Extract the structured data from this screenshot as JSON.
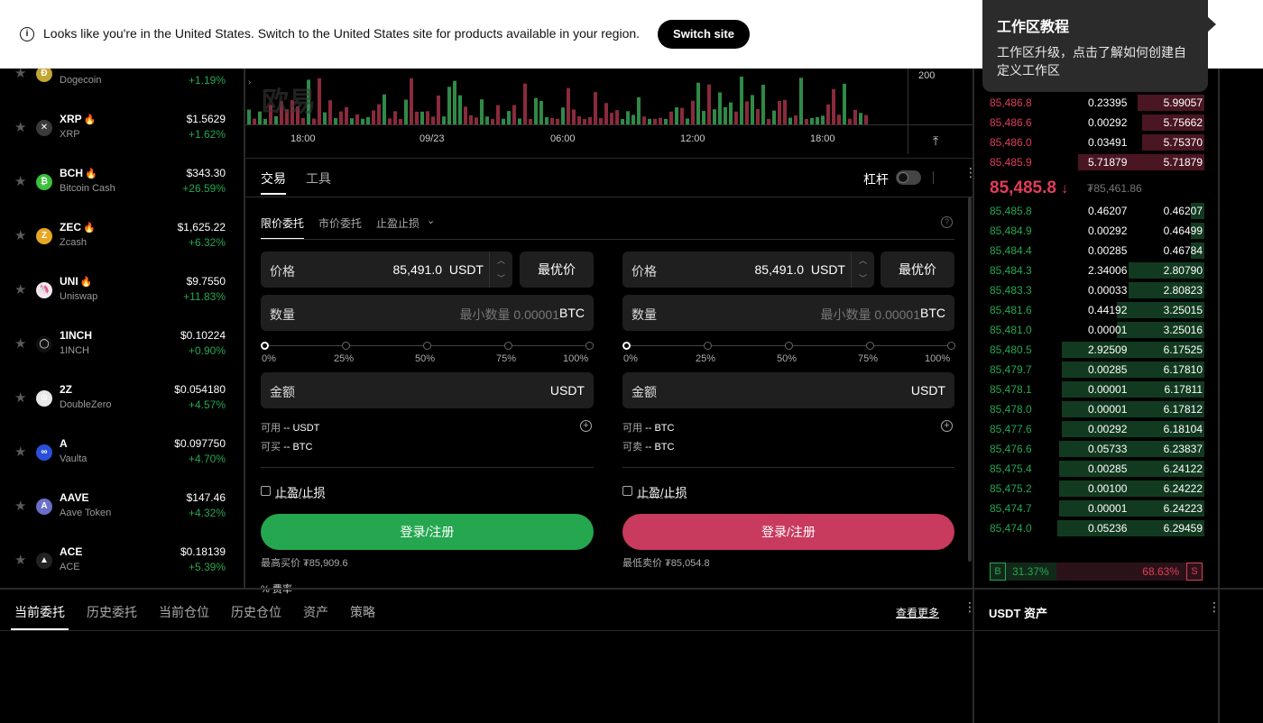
{
  "banner": {
    "message": "Looks like you're in the United States. Switch to the United States site for products available in your region.",
    "switch_label": "Switch site"
  },
  "tooltip": {
    "title": "工作区教程",
    "body": "工作区升级，点击了解如何创建自定义工作区"
  },
  "coins": [
    {
      "sym": "",
      "name": "Dogecoin",
      "price": "",
      "change": "+1.19%",
      "logo_color": "#c2a633",
      "logo_char": "Ð",
      "hot": false
    },
    {
      "sym": "XRP",
      "name": "XRP",
      "price": "$1.5629",
      "change": "+1.62%",
      "logo_color": "#3a3a3a",
      "logo_char": "✕",
      "hot": true
    },
    {
      "sym": "BCH",
      "name": "Bitcoin Cash",
      "price": "$343.30",
      "change": "+26.59%",
      "logo_color": "#3cbf3c",
      "logo_char": "₿",
      "hot": true
    },
    {
      "sym": "ZEC",
      "name": "Zcash",
      "price": "$1,625.22",
      "change": "+6.32%",
      "logo_color": "#e8a722",
      "logo_char": "Z",
      "hot": true
    },
    {
      "sym": "UNI",
      "name": "Uniswap",
      "price": "$9.7550",
      "change": "+11.83%",
      "logo_color": "#f5e6f0",
      "logo_char": "🦄",
      "hot": true
    },
    {
      "sym": "1INCH",
      "name": "1INCH",
      "price": "$0.10224",
      "change": "+0.90%",
      "logo_color": "#111111",
      "logo_char": "◯",
      "hot": false
    },
    {
      "sym": "2Z",
      "name": "DoubleZero",
      "price": "$0.054180",
      "change": "+4.57%",
      "logo_color": "#e8e8e8",
      "logo_char": "⊙",
      "hot": false
    },
    {
      "sym": "A",
      "name": "Vaulta",
      "price": "$0.097750",
      "change": "+4.70%",
      "logo_color": "#2a4fd8",
      "logo_char": "∞",
      "hot": false
    },
    {
      "sym": "AAVE",
      "name": "Aave Token",
      "price": "$147.46",
      "change": "+4.32%",
      "logo_color": "#6b6fc8",
      "logo_char": "A",
      "hot": false
    },
    {
      "sym": "ACE",
      "name": "ACE",
      "price": "$0.18139",
      "change": "+5.39%",
      "logo_color": "#222222",
      "logo_char": "▲",
      "hot": false
    }
  ],
  "chart": {
    "x_ticks": [
      "18:00",
      "09/23",
      "06:00",
      "12:00",
      "18:00"
    ],
    "y_tick": "200",
    "watermark": "欧易"
  },
  "trade": {
    "tab_trade": "交易",
    "tab_tools": "工具",
    "leverage_label": "杠杆",
    "order_types": [
      "限价委托",
      "市价委托",
      "止盈止损"
    ],
    "buy": {
      "price_label": "价格",
      "price_value": "85,491.0",
      "price_unit": "USDT",
      "best_label": "最优价",
      "qty_label": "数量",
      "qty_placeholder": "最小数量 0.00001",
      "qty_unit": "BTC",
      "amount_label": "金额",
      "amount_unit": "USDT",
      "avail_label": "可用",
      "avail_value": "-- USDT",
      "can_label": "可买",
      "can_value": "-- BTC",
      "tpsl_label": "止盈/止损",
      "button": "登录/注册",
      "limit_text": "最高买价 ₮85,909.6"
    },
    "sell": {
      "price_label": "价格",
      "price_value": "85,491.0",
      "price_unit": "USDT",
      "best_label": "最优价",
      "qty_label": "数量",
      "qty_placeholder": "最小数量 0.00001",
      "qty_unit": "BTC",
      "amount_label": "金额",
      "amount_unit": "USDT",
      "avail_label": "可用",
      "avail_value": "-- BTC",
      "can_label": "可卖",
      "can_value": "-- BTC",
      "tpsl_label": "止盈/止损",
      "button": "登录/注册",
      "limit_text": "最低卖价 ₮85,054.8"
    },
    "slider_labels": [
      "0%",
      "25%",
      "50%",
      "75%",
      "100%"
    ],
    "fee_label": "费率"
  },
  "orderbook": {
    "asks": [
      {
        "p": "85,486.8",
        "q": "0.23395",
        "t": "5.99057",
        "depth": 0.29
      },
      {
        "p": "85,486.6",
        "q": "0.00292",
        "t": "5.75662",
        "depth": 0.27
      },
      {
        "p": "85,486.0",
        "q": "0.03491",
        "t": "5.75370",
        "depth": 0.27
      },
      {
        "p": "85,485.9",
        "q": "5.71879",
        "t": "5.71879",
        "depth": 0.55
      }
    ],
    "last_price": "85,485.8",
    "mark_price": "₮85,461.86",
    "bids": [
      {
        "p": "85,485.8",
        "q": "0.46207",
        "t": "0.46207",
        "depth": 0.06
      },
      {
        "p": "85,484.9",
        "q": "0.00292",
        "t": "0.46499",
        "depth": 0.06
      },
      {
        "p": "85,484.4",
        "q": "0.00285",
        "t": "0.46784",
        "depth": 0.06
      },
      {
        "p": "85,484.3",
        "q": "2.34006",
        "t": "2.80790",
        "depth": 0.33
      },
      {
        "p": "85,483.3",
        "q": "0.00033",
        "t": "2.80823",
        "depth": 0.33
      },
      {
        "p": "85,481.6",
        "q": "0.44192",
        "t": "3.25015",
        "depth": 0.38
      },
      {
        "p": "85,481.0",
        "q": "0.00001",
        "t": "3.25016",
        "depth": 0.38
      },
      {
        "p": "85,480.5",
        "q": "2.92509",
        "t": "6.17525",
        "depth": 0.62
      },
      {
        "p": "85,479.7",
        "q": "0.00285",
        "t": "6.17810",
        "depth": 0.62
      },
      {
        "p": "85,478.1",
        "q": "0.00001",
        "t": "6.17811",
        "depth": 0.62
      },
      {
        "p": "85,478.0",
        "q": "0.00001",
        "t": "6.17812",
        "depth": 0.62
      },
      {
        "p": "85,477.6",
        "q": "0.00292",
        "t": "6.18104",
        "depth": 0.62
      },
      {
        "p": "85,476.6",
        "q": "0.05733",
        "t": "6.23837",
        "depth": 0.63
      },
      {
        "p": "85,475.4",
        "q": "0.00285",
        "t": "6.24122",
        "depth": 0.63
      },
      {
        "p": "85,475.2",
        "q": "0.00100",
        "t": "6.24222",
        "depth": 0.63
      },
      {
        "p": "85,474.7",
        "q": "0.00001",
        "t": "6.24223",
        "depth": 0.63
      },
      {
        "p": "85,474.0",
        "q": "0.05236",
        "t": "6.29459",
        "depth": 0.64
      }
    ],
    "buy_ratio": "31.37%",
    "sell_ratio": "68.63%",
    "buy_fraction": 0.3137,
    "b_label": "B",
    "s_label": "S"
  },
  "bottom": {
    "tabs": [
      "当前委托",
      "历史委托",
      "当前仓位",
      "历史仓位",
      "资产",
      "策略"
    ],
    "more": "查看更多",
    "assets_title": "USDT 资产"
  },
  "colors": {
    "up": "#25a750",
    "down": "#e03d5a",
    "buy_btn": "#25a750",
    "sell_btn": "#c83a5e"
  }
}
